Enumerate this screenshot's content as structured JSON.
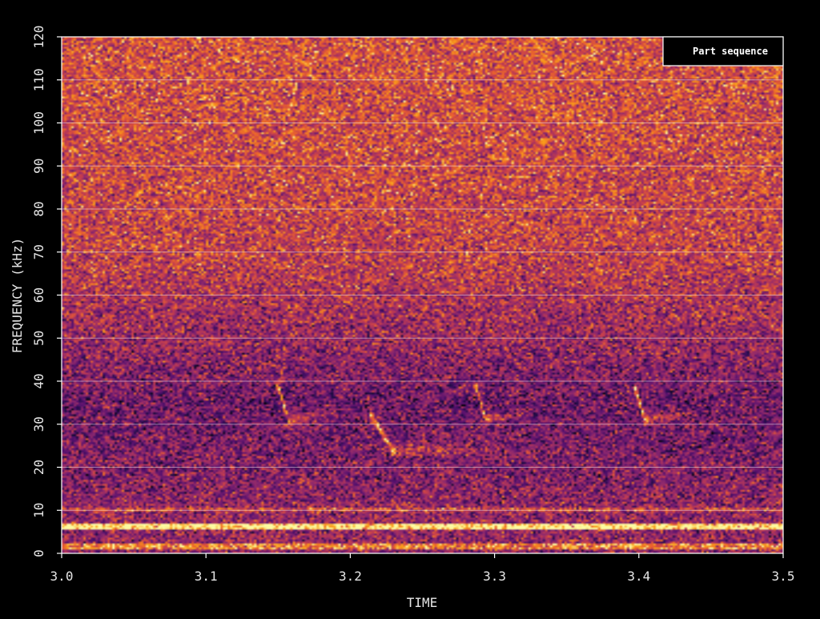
{
  "chart_data": {
    "type": "heatmap",
    "subtype": "spectrogram",
    "xlabel": "TIME",
    "ylabel": "FREQUENCY (kHz)",
    "xlim": [
      3.0,
      3.5
    ],
    "ylim": [
      0,
      120
    ],
    "x_ticks": [
      "3.0",
      "3.1",
      "3.2",
      "3.3",
      "3.4",
      "3.5"
    ],
    "y_ticks": [
      "0",
      "10",
      "20",
      "30",
      "40",
      "50",
      "60",
      "70",
      "80",
      "90",
      "100",
      "110",
      "120"
    ],
    "grid": "horizontal",
    "legend": {
      "position": "top-right",
      "entries": [
        "Part sequence"
      ]
    },
    "colormap": "inferno",
    "colors": {
      "background": "#000000",
      "axis": "#ffffff",
      "gridline": "#ffffff",
      "text": "#e6e6e6"
    },
    "calls": [
      {
        "t_start": 3.15,
        "t_end": 3.157,
        "f_high": 39,
        "f_low": 31,
        "tail_end": 3.2,
        "tail_freq": 33
      },
      {
        "t_start": 3.215,
        "t_end": 3.229,
        "f_high": 32,
        "f_low": 24,
        "tail_end": 3.3,
        "tail_freq": 24
      },
      {
        "t_start": 3.288,
        "t_end": 3.294,
        "f_high": 38,
        "f_low": 31,
        "tail_end": 3.33,
        "tail_freq": 33
      },
      {
        "t_start": 3.398,
        "t_end": 3.404,
        "f_high": 38,
        "f_low": 31,
        "tail_end": 3.44,
        "tail_freq": 33
      }
    ],
    "low_frequency_bands": [
      {
        "f_low": 5.5,
        "f_high": 7.0,
        "level": "strong"
      },
      {
        "f_low": 1.0,
        "f_high": 2.5,
        "level": "medium"
      },
      {
        "f_low": 9.5,
        "f_high": 10.5,
        "level": "weak"
      }
    ]
  }
}
